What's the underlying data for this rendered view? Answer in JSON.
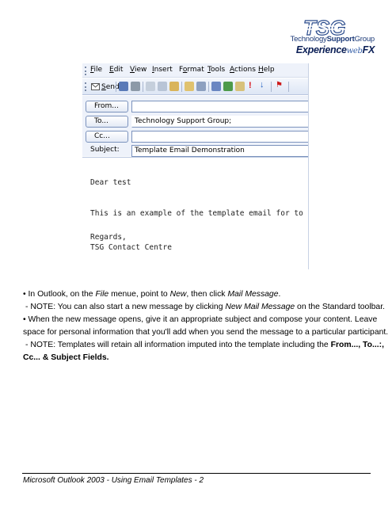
{
  "logo": {
    "mark": "TSG",
    "group_prefix": "Technology",
    "group_bold": "Support",
    "group_suffix": "Group",
    "experience_a": "Experience",
    "experience_web": "web",
    "experience_fx": "FX",
    "brand_color": "#1c3a78"
  },
  "outlook": {
    "menu": [
      {
        "u": "F",
        "rest": "ile"
      },
      {
        "u": "E",
        "rest": "dit"
      },
      {
        "u": "V",
        "rest": "iew"
      },
      {
        "u": "I",
        "rest": "nsert"
      },
      {
        "pre": "F",
        "u": "o",
        "rest": "rmat"
      },
      {
        "u": "T",
        "rest": "ools"
      },
      {
        "u": "A",
        "rest": "ctions"
      },
      {
        "u": "H",
        "rest": "elp"
      }
    ],
    "send_label_u": "S",
    "send_label_rest": "end",
    "from_button": "From...",
    "to_button": "To...",
    "cc_button": "Cc...",
    "from_value": "",
    "to_value": "Technology Support Group;",
    "cc_value": "",
    "subject_label": "Subject:",
    "subject_value": "Template Email Demonstration",
    "body": {
      "greeting": "Dear test",
      "line1": "This is an example of the template email for to be saved.",
      "closing": "Regards,",
      "signature": "TSG Contact Centre"
    }
  },
  "instructions": {
    "b1_a": "• In Outlook, on the ",
    "b1_file": "File",
    "b1_b": " menue, point to ",
    "b1_new": "New",
    "b1_c": ", then click ",
    "b1_mail": "Mail Message",
    "b1_d": ".",
    "n1_a": "- NOTE: You can also start a new message by clicking ",
    "n1_new": "New Mail Message",
    "n1_b": " on the Standard toolbar.",
    "b2_line1": "• When the new message opens, give it an appropriate subject and compose your content.  Leave",
    "b2_line2": "space for personal information that you'll add when you send the message to a particular participant.",
    "n2_a": "- NOTE: Templates will retain all information imputed into the template including the ",
    "n2_bold1": "From..., To...:,",
    "n2_bold2": "Cc... & Subject Fields."
  },
  "footer": "Microsoft Outlook 2003 - Using Email Templates - 2"
}
